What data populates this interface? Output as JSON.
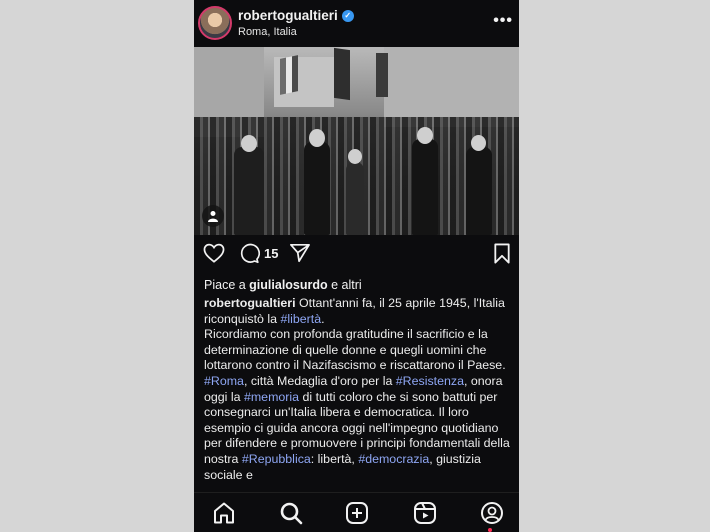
{
  "header": {
    "username": "robertogualtieri",
    "location": "Roma, Italia"
  },
  "actions": {
    "comment_count": "15"
  },
  "likes": {
    "prefix": "Piace a ",
    "user": "giulialosurdo",
    "suffix": " e altri"
  },
  "caption": {
    "username": "robertogualtieri",
    "p1a": " Ottant'anni fa, il 25 aprile 1945, l'Italia riconquistò la ",
    "tag_liberta": "#libertà",
    "p1b": ".",
    "p2": "Ricordiamo con profonda gratitudine il sacrificio e la determinazione di quelle donne e quegli uomini che lottarono contro il Nazifascismo e riscattarono il Paese.",
    "tag_roma": "#Roma",
    "p3a": ", città Medaglia d'oro per la ",
    "tag_resistenza": "#Resistenza",
    "p3b": ", onora oggi la ",
    "tag_memoria": "#memoria",
    "p3c": " di tutti coloro che si sono battuti per consegnarci un'Italia libera e democratica. Il loro esempio ci guida ancora oggi nell'impegno quotidiano per difendere e promuovere i principi fondamentali della nostra ",
    "tag_repubblica": "#Repubblica",
    "p3d": ": libertà, ",
    "tag_democrazia": "#democrazia",
    "p3e": ", giustizia sociale e"
  },
  "icons": {
    "verified": "verified-badge-icon",
    "more": "more-options-icon",
    "like": "heart-icon",
    "comment": "comment-icon",
    "share": "send-icon",
    "save": "bookmark-icon",
    "user_tag": "user-tag-icon",
    "nav": [
      "home-icon",
      "search-icon",
      "create-icon",
      "reels-icon",
      "profile-icon"
    ]
  },
  "colors": {
    "background": "#0c0c0e",
    "hashtag": "#8ea6f3",
    "verified": "#3897f0",
    "notification_dot": "#ff2d55"
  }
}
